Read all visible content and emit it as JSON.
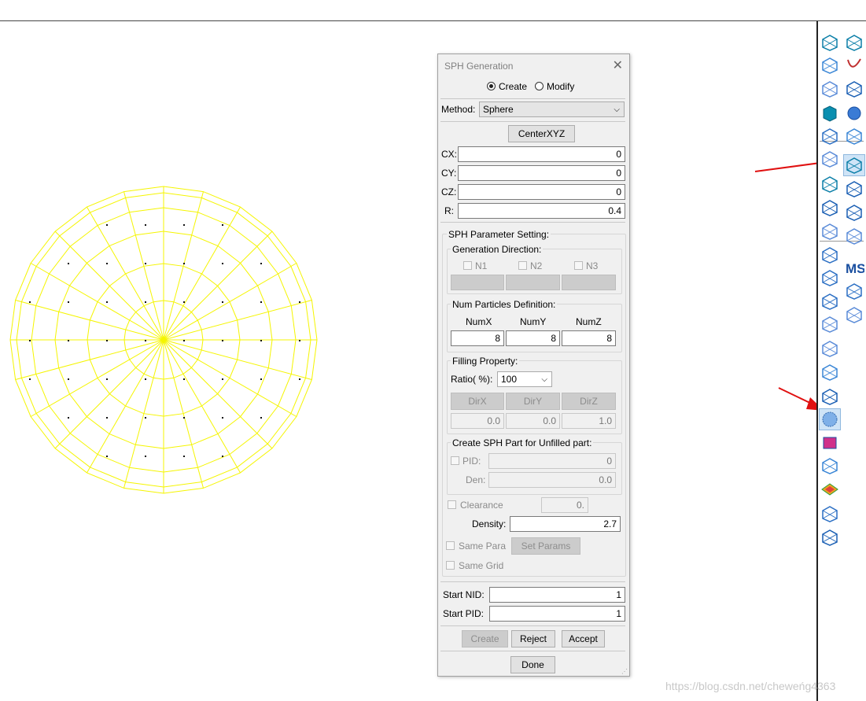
{
  "dialog": {
    "title": "SPH Generation",
    "mode_create": "Create",
    "mode_modify": "Modify",
    "method_label": "Method:",
    "method_value": "Sphere",
    "center_button": "CenterXYZ",
    "cx_label": "CX:",
    "cx_value": "0",
    "cy_label": "CY:",
    "cy_value": "0",
    "cz_label": "CZ:",
    "cz_value": "0",
    "r_label": "R:",
    "r_value": "0.4",
    "param_title": "SPH Parameter Setting:",
    "gen_dir_title": "Generation Direction:",
    "n1": "N1",
    "n2": "N2",
    "n3": "N3",
    "num_title": "Num Particles Definition:",
    "numx_label": "NumX",
    "numy_label": "NumY",
    "numz_label": "NumZ",
    "numx_value": "8",
    "numy_value": "8",
    "numz_value": "8",
    "fill_title": "Filling Property:",
    "ratio_label": "Ratio( %):",
    "ratio_value": "100",
    "dirx": "DirX",
    "diry": "DirY",
    "dirz": "DirZ",
    "dirx_value": "0.0",
    "diry_value": "0.0",
    "dirz_value": "1.0",
    "unfilled_title": "Create SPH Part for Unfilled part:",
    "pid_label": "PID:",
    "pid_value": "0",
    "den_label": "Den:",
    "den_value": "0.0",
    "clearance_label": "Clearance",
    "clearance_value": "0.",
    "density_label": "Density:",
    "density_value": "2.7",
    "same_para_label": "Same Para",
    "set_params_button": "Set Params",
    "same_grid_label": "Same Grid",
    "start_nid_label": "Start NID:",
    "start_nid_value": "1",
    "start_pid_label": "Start PID:",
    "start_pid_value": "1",
    "create_button": "Create",
    "reject_button": "Reject",
    "accept_button": "Accept",
    "done_button": "Done"
  },
  "sidebar": {
    "tools_left": [
      "box-icon",
      "surface-mesh-icon",
      "grid-mesh-icon",
      "solid-cube-icon",
      "spline-mesh-icon",
      "node-grid-icon",
      "triangle-mesh-icon",
      "block-mesh-icon",
      "tube-mesh-icon",
      "node-select-icon",
      "pencil-icon",
      "search-mesh-icon",
      "fold-mesh-icon",
      "cube-mesh-icon",
      "node-connect-icon",
      "split-icon",
      "sph-generation-icon",
      "particle-block-icon",
      "ms-node-icon",
      "contour-icon",
      "vector-mesh-icon",
      "shape-mesh-icon"
    ],
    "tools_right": [
      "move-box-icon",
      "curve-icon",
      "plane-icon",
      "sphere-icon",
      "magnify-icon",
      "sph-mesh-icon",
      "mesh-table-icon",
      "mesh-tools-icon",
      "mesh-edit-icon",
      "ms-label-icon",
      "stethoscope-icon",
      "part-info-icon"
    ],
    "ms_label": "MS"
  },
  "colors": {
    "mesh": "#f5f500",
    "selected_tool": "#cfe4f7",
    "arrow": "#e01010"
  },
  "watermark": "https://blog.csdn.net/cheweńg4363"
}
